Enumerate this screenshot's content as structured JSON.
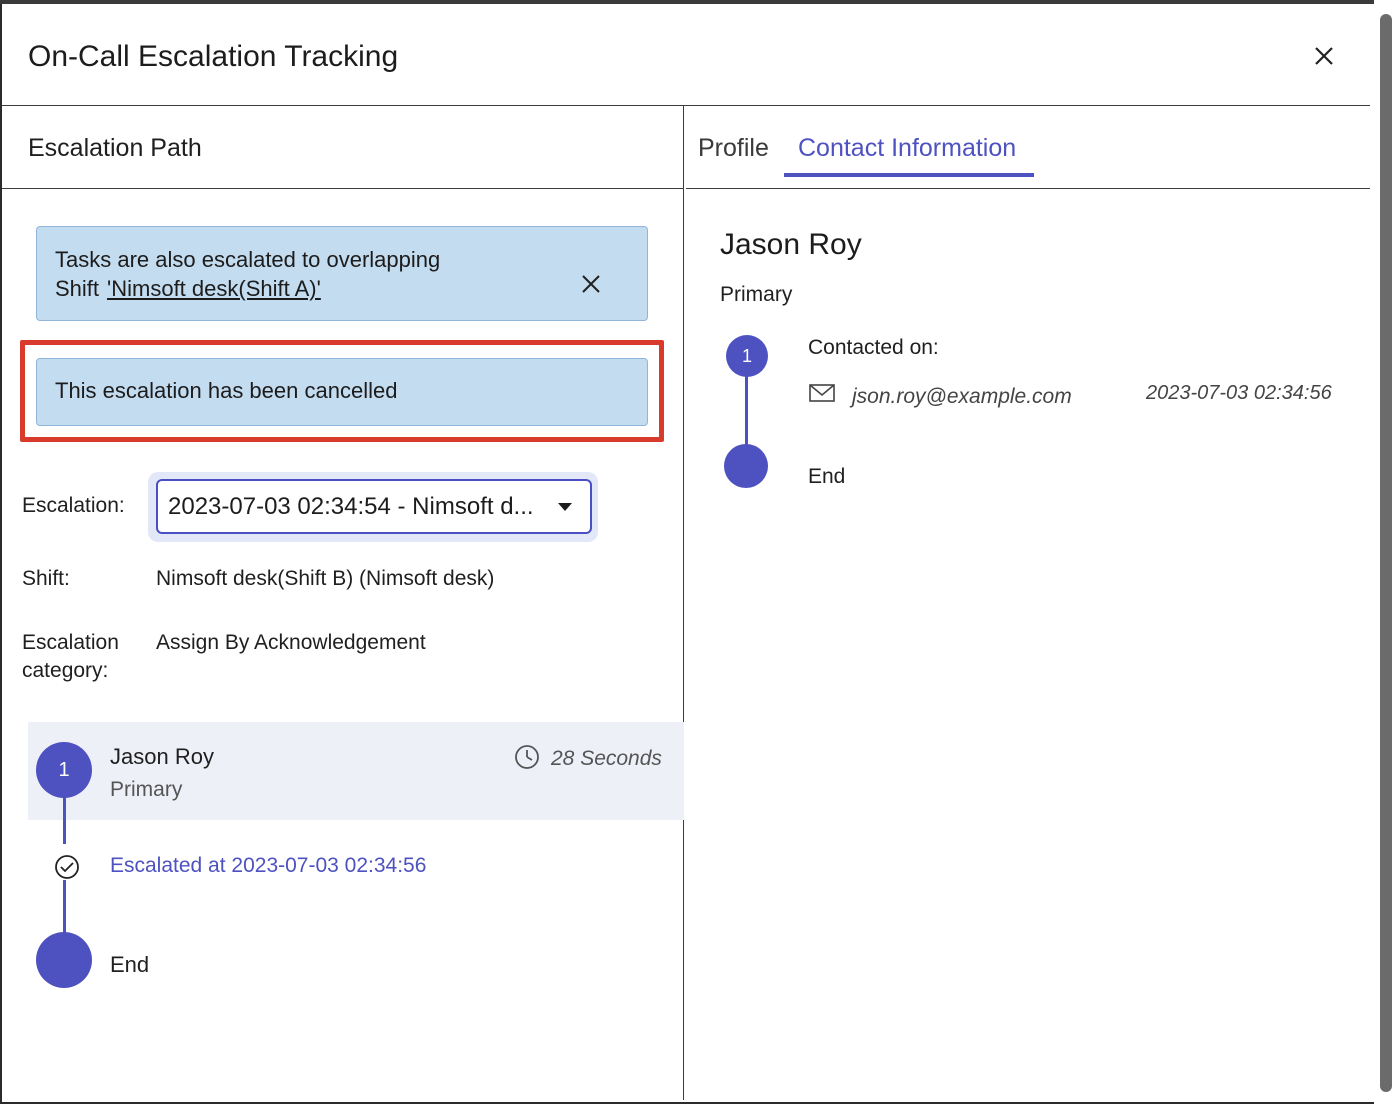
{
  "dialog": {
    "title": "On-Call Escalation Tracking"
  },
  "left": {
    "heading": "Escalation Path",
    "banner_overlap": {
      "text_line1": "Tasks are also escalated to overlapping",
      "text_line2_prefix": "Shift",
      "link": "'Nimsoft desk(Shift A)'"
    },
    "banner_cancelled": {
      "text": "This escalation has been cancelled"
    },
    "escalation": {
      "label": "Escalation:",
      "selected": "2023-07-03 02:34:54 - Nimsoft d..."
    },
    "shift": {
      "label": "Shift:",
      "value": "Nimsoft desk(Shift B) (Nimsoft desk)"
    },
    "category": {
      "label_line1": "Escalation",
      "label_line2": "category:",
      "value": "Assign By Acknowledgement"
    },
    "steps": [
      {
        "number": "1",
        "name": "Jason Roy",
        "role": "Primary",
        "duration": "28 Seconds"
      }
    ],
    "escalated_text": "Escalated at 2023-07-03 02:34:56",
    "end_label": "End"
  },
  "right": {
    "tabs": [
      {
        "label": "Profile",
        "active": false
      },
      {
        "label": "Contact Information",
        "active": true
      }
    ],
    "contact": {
      "name": "Jason Roy",
      "role": "Primary",
      "step_number": "1",
      "contacted_label": "Contacted on:",
      "email": "json.roy@example.com",
      "timestamp": "2023-07-03 02:34:56",
      "end_label": "End"
    }
  },
  "colors": {
    "accent": "#4e52c0",
    "banner_bg": "#c4dcf0",
    "highlight": "#d83a2b"
  },
  "icons": [
    "close-icon",
    "clock-icon",
    "check-circle-icon",
    "mail-icon",
    "caret-down-icon"
  ]
}
